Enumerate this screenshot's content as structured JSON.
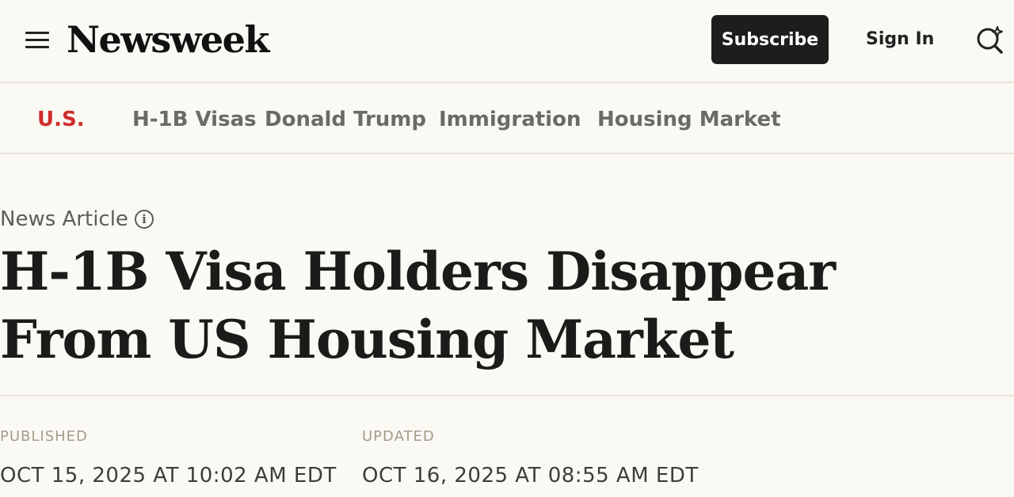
{
  "header": {
    "menu_icon": "hamburger-menu-icon",
    "logo": "Newsweek",
    "subscribe_label": "Subscribe",
    "signin_label": "Sign In",
    "search_icon": "search-sparkle-icon"
  },
  "nav": {
    "section": "U.S.",
    "items": [
      {
        "label": "H-1B Visas"
      },
      {
        "label": "Donald Trump"
      },
      {
        "label": "Immigration"
      },
      {
        "label": "Housing Market"
      }
    ]
  },
  "article": {
    "type_label": "News Article",
    "info_icon": "info-icon",
    "headline": "H-1B Visa Holders Disappear From US Housing Market",
    "published_label": "PUBLISHED",
    "published_value": "OCT 15, 2025 AT 10:02 AM EDT",
    "updated_label": "UPDATED",
    "updated_value": "OCT 16, 2025 AT 08:55 AM EDT"
  },
  "colors": {
    "background": "#fbf9f4",
    "accent_red": "#cf2c2b",
    "button_dark": "#1d1d1b"
  }
}
